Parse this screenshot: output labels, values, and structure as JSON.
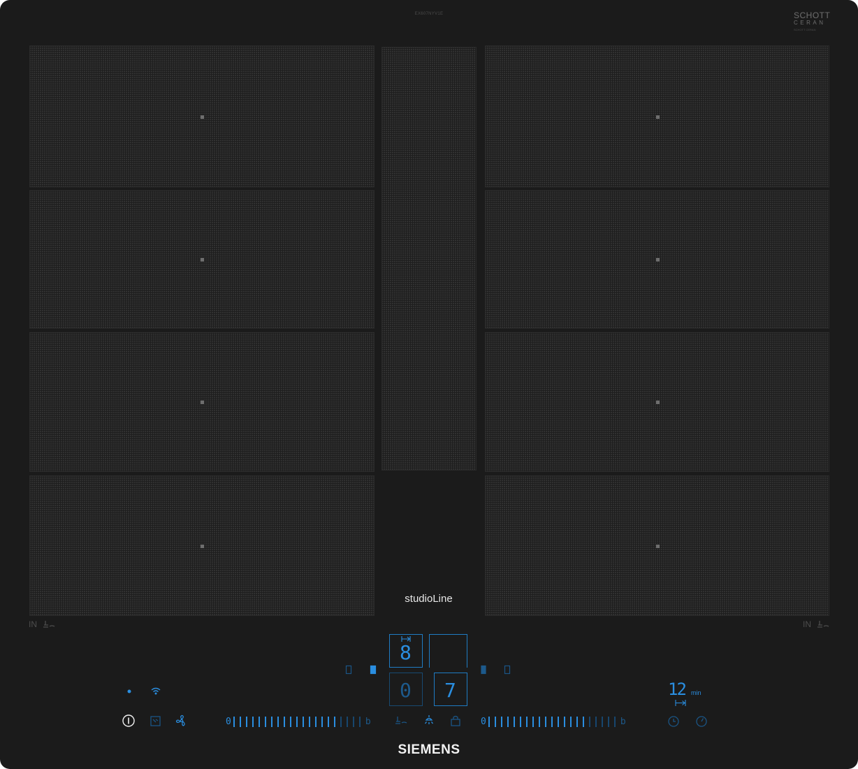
{
  "top": {
    "model_code": "EX607NYV1E",
    "manufacturer_logo": {
      "line1": "SCHOTT",
      "line2": "CERAN",
      "line3": "SCHOTT CERAN"
    }
  },
  "cooking_zones": {
    "left_column": [
      "zone-left-1",
      "zone-left-2",
      "zone-left-3",
      "zone-left-4"
    ],
    "right_column": [
      "zone-right-1",
      "zone-right-2",
      "zone-right-3",
      "zone-right-4"
    ]
  },
  "brand_line": "studioLine",
  "induction_label_left": "IN",
  "induction_label_right": "IN",
  "displays": {
    "top_left_value": "8",
    "bottom_left_value": "0",
    "bottom_right_value": "7",
    "timer_value": "12",
    "timer_unit": "min"
  },
  "slider_left": {
    "min_label": "0",
    "max_label": "b",
    "active_fraction": 0.82
  },
  "slider_right": {
    "min_label": "0",
    "max_label": "b",
    "active_fraction": 0.78
  },
  "icons": {
    "left_controls": [
      "info-icon",
      "cooking-sensor-icon",
      "hood-fan-icon"
    ],
    "center_controls": [
      "pan-sensor-icon",
      "hood-light-icon",
      "lock-icon"
    ],
    "right_controls": [
      "clock-icon",
      "timer-stopwatch-icon"
    ]
  },
  "brand": "SIEMENS",
  "colors": {
    "accent": "#2a8ee0",
    "accent_dim": "#1d5a8c",
    "surface": "#1b1b1b",
    "text": "#f2f2f2"
  }
}
